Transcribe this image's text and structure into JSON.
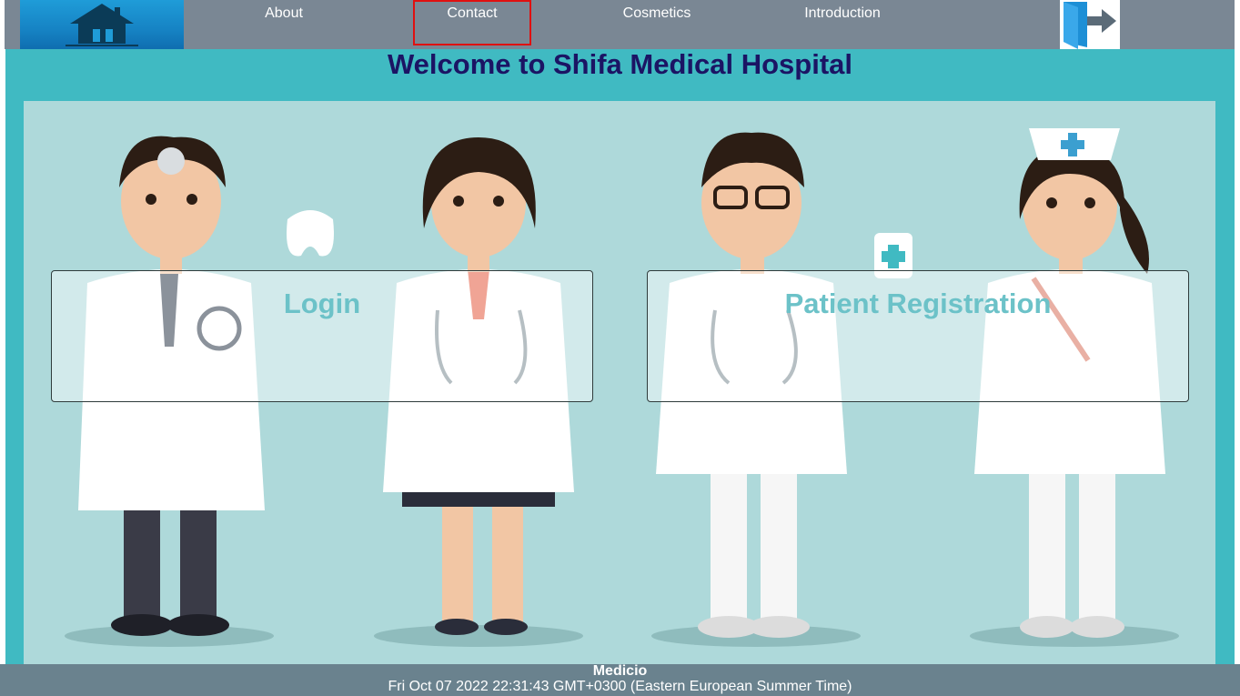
{
  "nav": {
    "logo_icon": "hospital-house-icon",
    "items": [
      {
        "label": "About"
      },
      {
        "label": "Contact"
      },
      {
        "label": "Cosmetics"
      },
      {
        "label": "Introduction"
      }
    ],
    "active_item": "Contact",
    "logout_icon": "logout-arrow-icon"
  },
  "main": {
    "title": "Welcome to Shifa Medical Hospital",
    "hero_illustration": "doctors-and-nurse-illustration",
    "cards": [
      {
        "label": "Login"
      },
      {
        "label": "Patient Registration"
      }
    ]
  },
  "footer": {
    "brand": "Medicio",
    "datetime": "Fri Oct 07 2022 22:31:43 GMT+0300 (Eastern European Summer Time)"
  },
  "colors": {
    "navbar": "#7a8794",
    "main_bg": "#40bac2",
    "hero_bg": "#aed9da",
    "title": "#1b1464",
    "card_text": "#6cc2c8",
    "footer": "#6a828e",
    "active_outline": "#e01010"
  }
}
